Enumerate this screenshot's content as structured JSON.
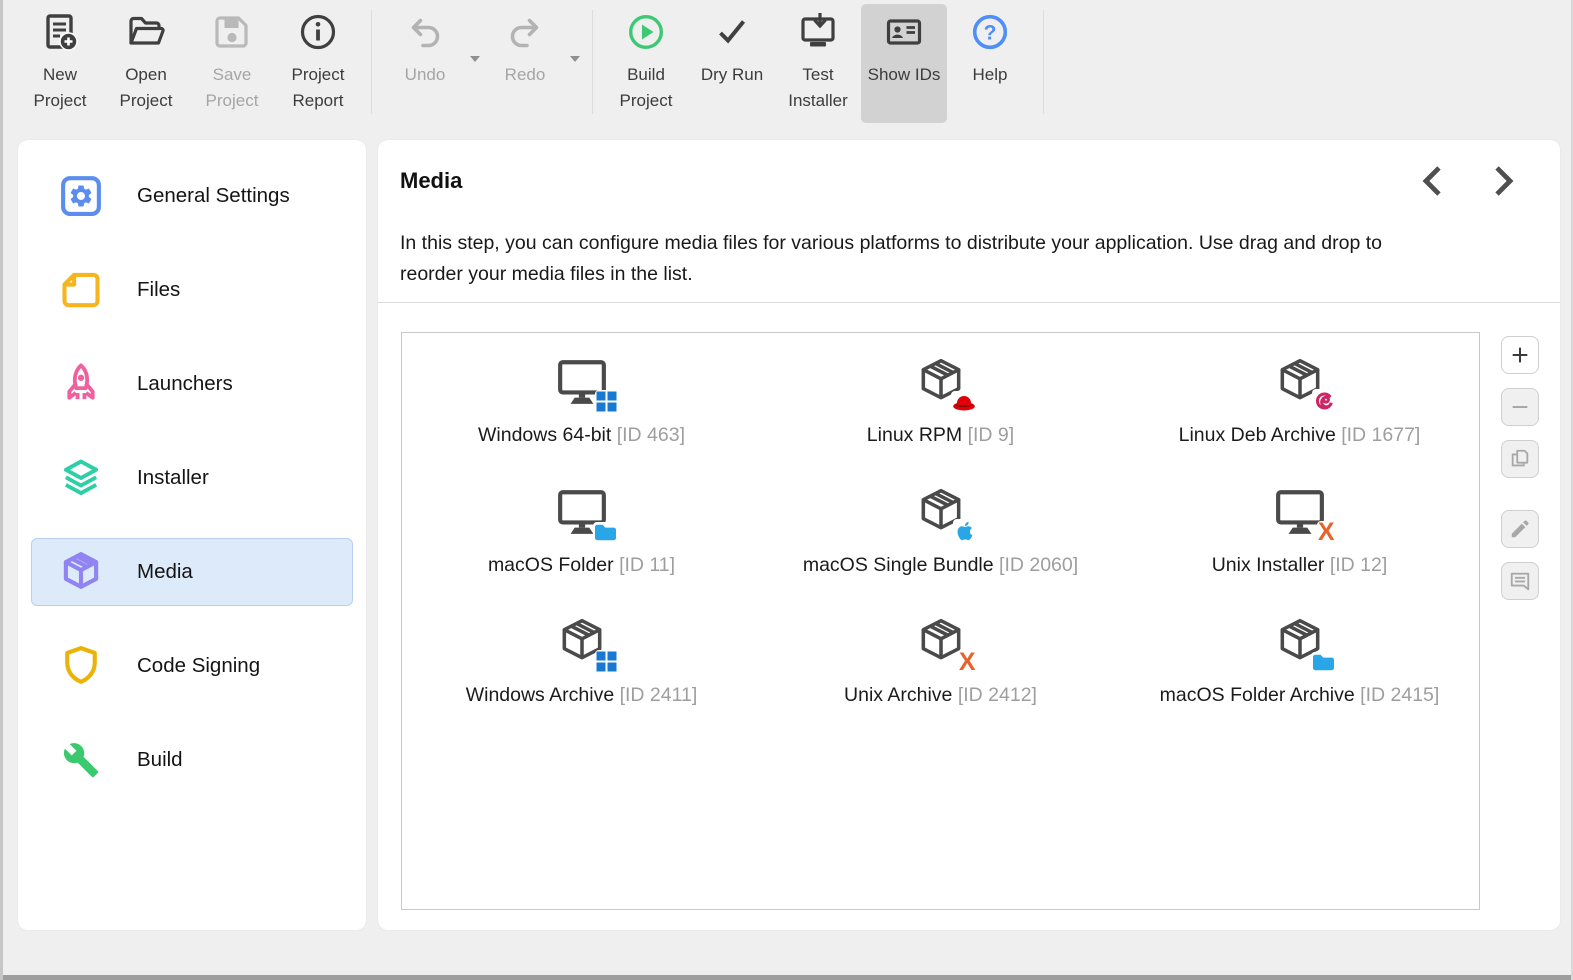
{
  "toolbar": {
    "items": [
      {
        "label": "New Project",
        "icon": "new-project-icon",
        "enabled": true,
        "active": false
      },
      {
        "label": "Open Project",
        "icon": "open-project-icon",
        "enabled": true,
        "active": false
      },
      {
        "label": "Save Project",
        "icon": "save-project-icon",
        "enabled": false,
        "active": false
      },
      {
        "label": "Project Report",
        "icon": "project-report-icon",
        "enabled": true,
        "active": false
      },
      {
        "label": "Undo",
        "icon": "undo-icon",
        "enabled": false,
        "active": false,
        "has_dropdown": true
      },
      {
        "label": "Redo",
        "icon": "redo-icon",
        "enabled": false,
        "active": false,
        "has_dropdown": true
      },
      {
        "label": "Build Project",
        "icon": "build-project-icon",
        "enabled": true,
        "active": false
      },
      {
        "label": "Dry Run",
        "icon": "dry-run-icon",
        "enabled": true,
        "active": false
      },
      {
        "label": "Test Installer",
        "icon": "test-installer-icon",
        "enabled": true,
        "active": false
      },
      {
        "label": "Show IDs",
        "icon": "show-ids-icon",
        "enabled": true,
        "active": true
      },
      {
        "label": "Help",
        "icon": "help-icon",
        "enabled": true,
        "active": false
      }
    ]
  },
  "sidebar": {
    "items": [
      {
        "label": "General Settings",
        "icon": "gear-icon",
        "color": "#5b8def",
        "selected": false
      },
      {
        "label": "Files",
        "icon": "files-icon",
        "color": "#f5b521",
        "selected": false
      },
      {
        "label": "Launchers",
        "icon": "rocket-icon",
        "color": "#f0609e",
        "selected": false
      },
      {
        "label": "Installer",
        "icon": "layers-icon",
        "color": "#2ecfa8",
        "selected": false
      },
      {
        "label": "Media",
        "icon": "cube-icon",
        "color": "#8f84f2",
        "selected": true
      },
      {
        "label": "Code Signing",
        "icon": "shield-icon",
        "color": "#eab308",
        "selected": false
      },
      {
        "label": "Build",
        "icon": "wrench-icon",
        "color": "#3bc96f",
        "selected": false
      }
    ]
  },
  "main": {
    "title": "Media",
    "description": "In this step, you can configure media files for various platforms to distribute your application. Use drag and drop to reorder your media files in the list.",
    "selected_state_color": "#ddeafa",
    "media_items": [
      {
        "name": "Windows 64-bit",
        "id_label": "[ID 463]",
        "base": "monitor",
        "badge": "windows-logo"
      },
      {
        "name": "Linux RPM",
        "id_label": "[ID 9]",
        "base": "box",
        "badge": "red-hat"
      },
      {
        "name": "Linux Deb Archive",
        "id_label": "[ID 1677]",
        "base": "box",
        "badge": "debian-swirl"
      },
      {
        "name": "macOS Folder",
        "id_label": "[ID 11]",
        "base": "monitor",
        "badge": "blue-folder"
      },
      {
        "name": "macOS Single Bundle",
        "id_label": "[ID 2060]",
        "base": "box",
        "badge": "apple-logo"
      },
      {
        "name": "Unix Installer",
        "id_label": "[ID 12]",
        "base": "monitor",
        "badge": "orange-x"
      },
      {
        "name": "Windows Archive",
        "id_label": "[ID 2411]",
        "base": "box",
        "badge": "windows-logo"
      },
      {
        "name": "Unix Archive",
        "id_label": "[ID 2412]",
        "base": "box",
        "badge": "orange-x"
      },
      {
        "name": "macOS Folder Archive",
        "id_label": "[ID 2415]",
        "base": "box",
        "badge": "blue-folder"
      }
    ],
    "side_buttons": [
      {
        "icon": "plus-icon",
        "enabled": true
      },
      {
        "icon": "minus-icon",
        "enabled": false
      },
      {
        "icon": "duplicate-icon",
        "enabled": false
      },
      {
        "icon": "edit-icon",
        "enabled": false
      },
      {
        "icon": "comment-icon",
        "enabled": false
      }
    ],
    "badge_x_glyph": "X"
  },
  "colors": {
    "windows_blue": "#1878d2",
    "mac_blue": "#29a6e8",
    "redhat_red": "#e00007",
    "debian_magenta": "#ce2566",
    "unix_orange": "#e8632c",
    "build_green": "#3dc974",
    "help_blue": "#4f8ef7"
  }
}
